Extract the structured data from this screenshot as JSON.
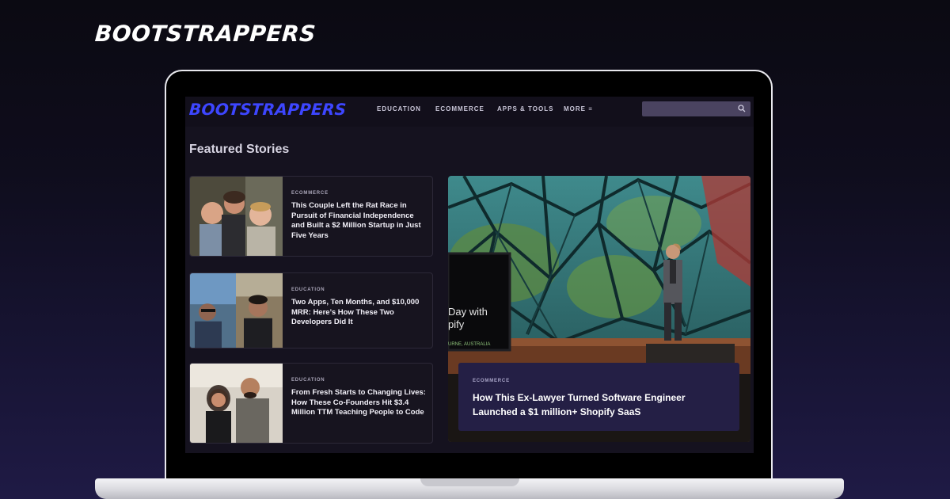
{
  "brand": {
    "name": "BOOTSTRAPPERS"
  },
  "site": {
    "logo": "BOOTSTRAPPERS",
    "nav": [
      {
        "label": "EDUCATION"
      },
      {
        "label": "ECOMMERCE"
      },
      {
        "label": "APPS & TOOLS"
      },
      {
        "label": "MORE ≡"
      }
    ],
    "search": {
      "placeholder": "",
      "icon": "search-icon"
    }
  },
  "main": {
    "section_title": "Featured Stories",
    "stories": [
      {
        "category": "ECOMMERCE",
        "title": "This Couple Left the Rat Race in Pursuit of Financial Independence and Built a $2 Million Startup in Just Five Years"
      },
      {
        "category": "EDUCATION",
        "title": "Two Apps, Ten Months, and $10,000 MRR: Here’s How These Two Developers Did It"
      },
      {
        "category": "EDUCATION",
        "title": "From Fresh Starts to Changing Lives: How These Co-Founders Hit $3.4 Million TTM Teaching People to Code"
      }
    ],
    "featured": {
      "category": "ECOMMERCE",
      "title": "How This Ex-Lawyer Turned Software Engineer Launched a $1 million+ Shopify SaaS",
      "slide_text_1": "Day with",
      "slide_text_2": "pify",
      "slide_text_3": "URNE, AUSTRALIA"
    }
  },
  "colors": {
    "accent": "#3d46ff",
    "overlay": "#241f45",
    "background": "#15121f"
  }
}
